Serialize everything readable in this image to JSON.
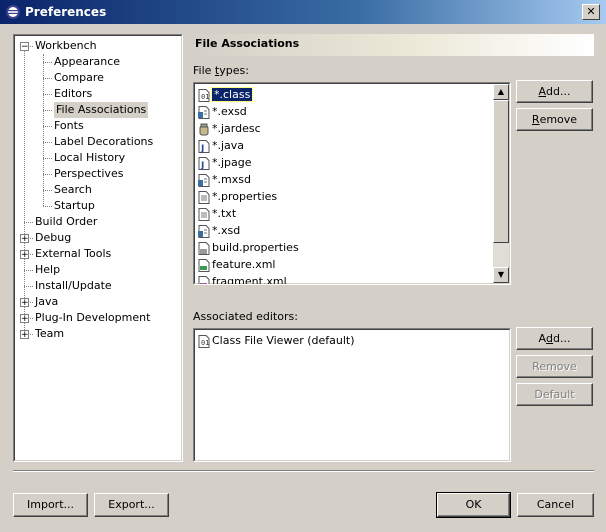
{
  "window": {
    "title": "Preferences",
    "close_glyph": "✕"
  },
  "tree": {
    "items": [
      {
        "label": "Workbench",
        "level": 0,
        "expander": "−"
      },
      {
        "label": "Appearance",
        "level": 1
      },
      {
        "label": "Compare",
        "level": 1
      },
      {
        "label": "Editors",
        "level": 1
      },
      {
        "label": "File Associations",
        "level": 1,
        "selected": true
      },
      {
        "label": "Fonts",
        "level": 1
      },
      {
        "label": "Label Decorations",
        "level": 1
      },
      {
        "label": "Local History",
        "level": 1
      },
      {
        "label": "Perspectives",
        "level": 1
      },
      {
        "label": "Search",
        "level": 1
      },
      {
        "label": "Startup",
        "level": 1
      },
      {
        "label": "Build Order",
        "level": 0
      },
      {
        "label": "Debug",
        "level": 0,
        "expander": "+"
      },
      {
        "label": "External Tools",
        "level": 0,
        "expander": "+"
      },
      {
        "label": "Help",
        "level": 0
      },
      {
        "label": "Install/Update",
        "level": 0
      },
      {
        "label": "Java",
        "level": 0,
        "expander": "+"
      },
      {
        "label": "Plug-In Development",
        "level": 0,
        "expander": "+"
      },
      {
        "label": "Team",
        "level": 0,
        "expander": "+"
      }
    ]
  },
  "page": {
    "title": "File Associations",
    "file_types_label_pre": "File ",
    "file_types_label_mnemonic": "t",
    "file_types_label_post": "ypes:",
    "associated_editors_label": "Associated editors:",
    "file_types": [
      {
        "name": "*.class",
        "icon": "class-file-icon",
        "selected": true
      },
      {
        "name": "*.exsd",
        "icon": "xml-file-icon"
      },
      {
        "name": "*.jardesc",
        "icon": "jar-desc-icon"
      },
      {
        "name": "*.java",
        "icon": "java-file-icon"
      },
      {
        "name": "*.jpage",
        "icon": "java-file-icon"
      },
      {
        "name": "*.mxsd",
        "icon": "xml-file-icon"
      },
      {
        "name": "*.properties",
        "icon": "text-file-icon"
      },
      {
        "name": "*.txt",
        "icon": "text-file-icon"
      },
      {
        "name": "*.xsd",
        "icon": "xml-file-icon"
      },
      {
        "name": "build.properties",
        "icon": "properties-file-icon"
      },
      {
        "name": "feature.xml",
        "icon": "feature-file-icon"
      },
      {
        "name": "fragment.xml",
        "icon": "fragment-file-icon"
      }
    ],
    "editors": [
      {
        "name": "Class File Viewer (default)",
        "icon": "class-file-viewer-icon"
      }
    ],
    "file_type_buttons": {
      "add_mnemonic": "A",
      "add_rest": "dd...",
      "remove_mnemonic": "R",
      "remove_rest": "emove"
    },
    "editor_buttons": {
      "add_pre": "A",
      "add_mnemonic": "d",
      "add_rest": "d...",
      "remove_label": "Remove",
      "default_label": "Default"
    }
  },
  "footer": {
    "import_label": "Import...",
    "export_label": "Export...",
    "ok_label": "OK",
    "cancel_label": "Cancel"
  },
  "colors": {
    "title_bar": "#0a246a",
    "dialog_bg": "#d4d0c8",
    "selection": "#0a246a"
  }
}
